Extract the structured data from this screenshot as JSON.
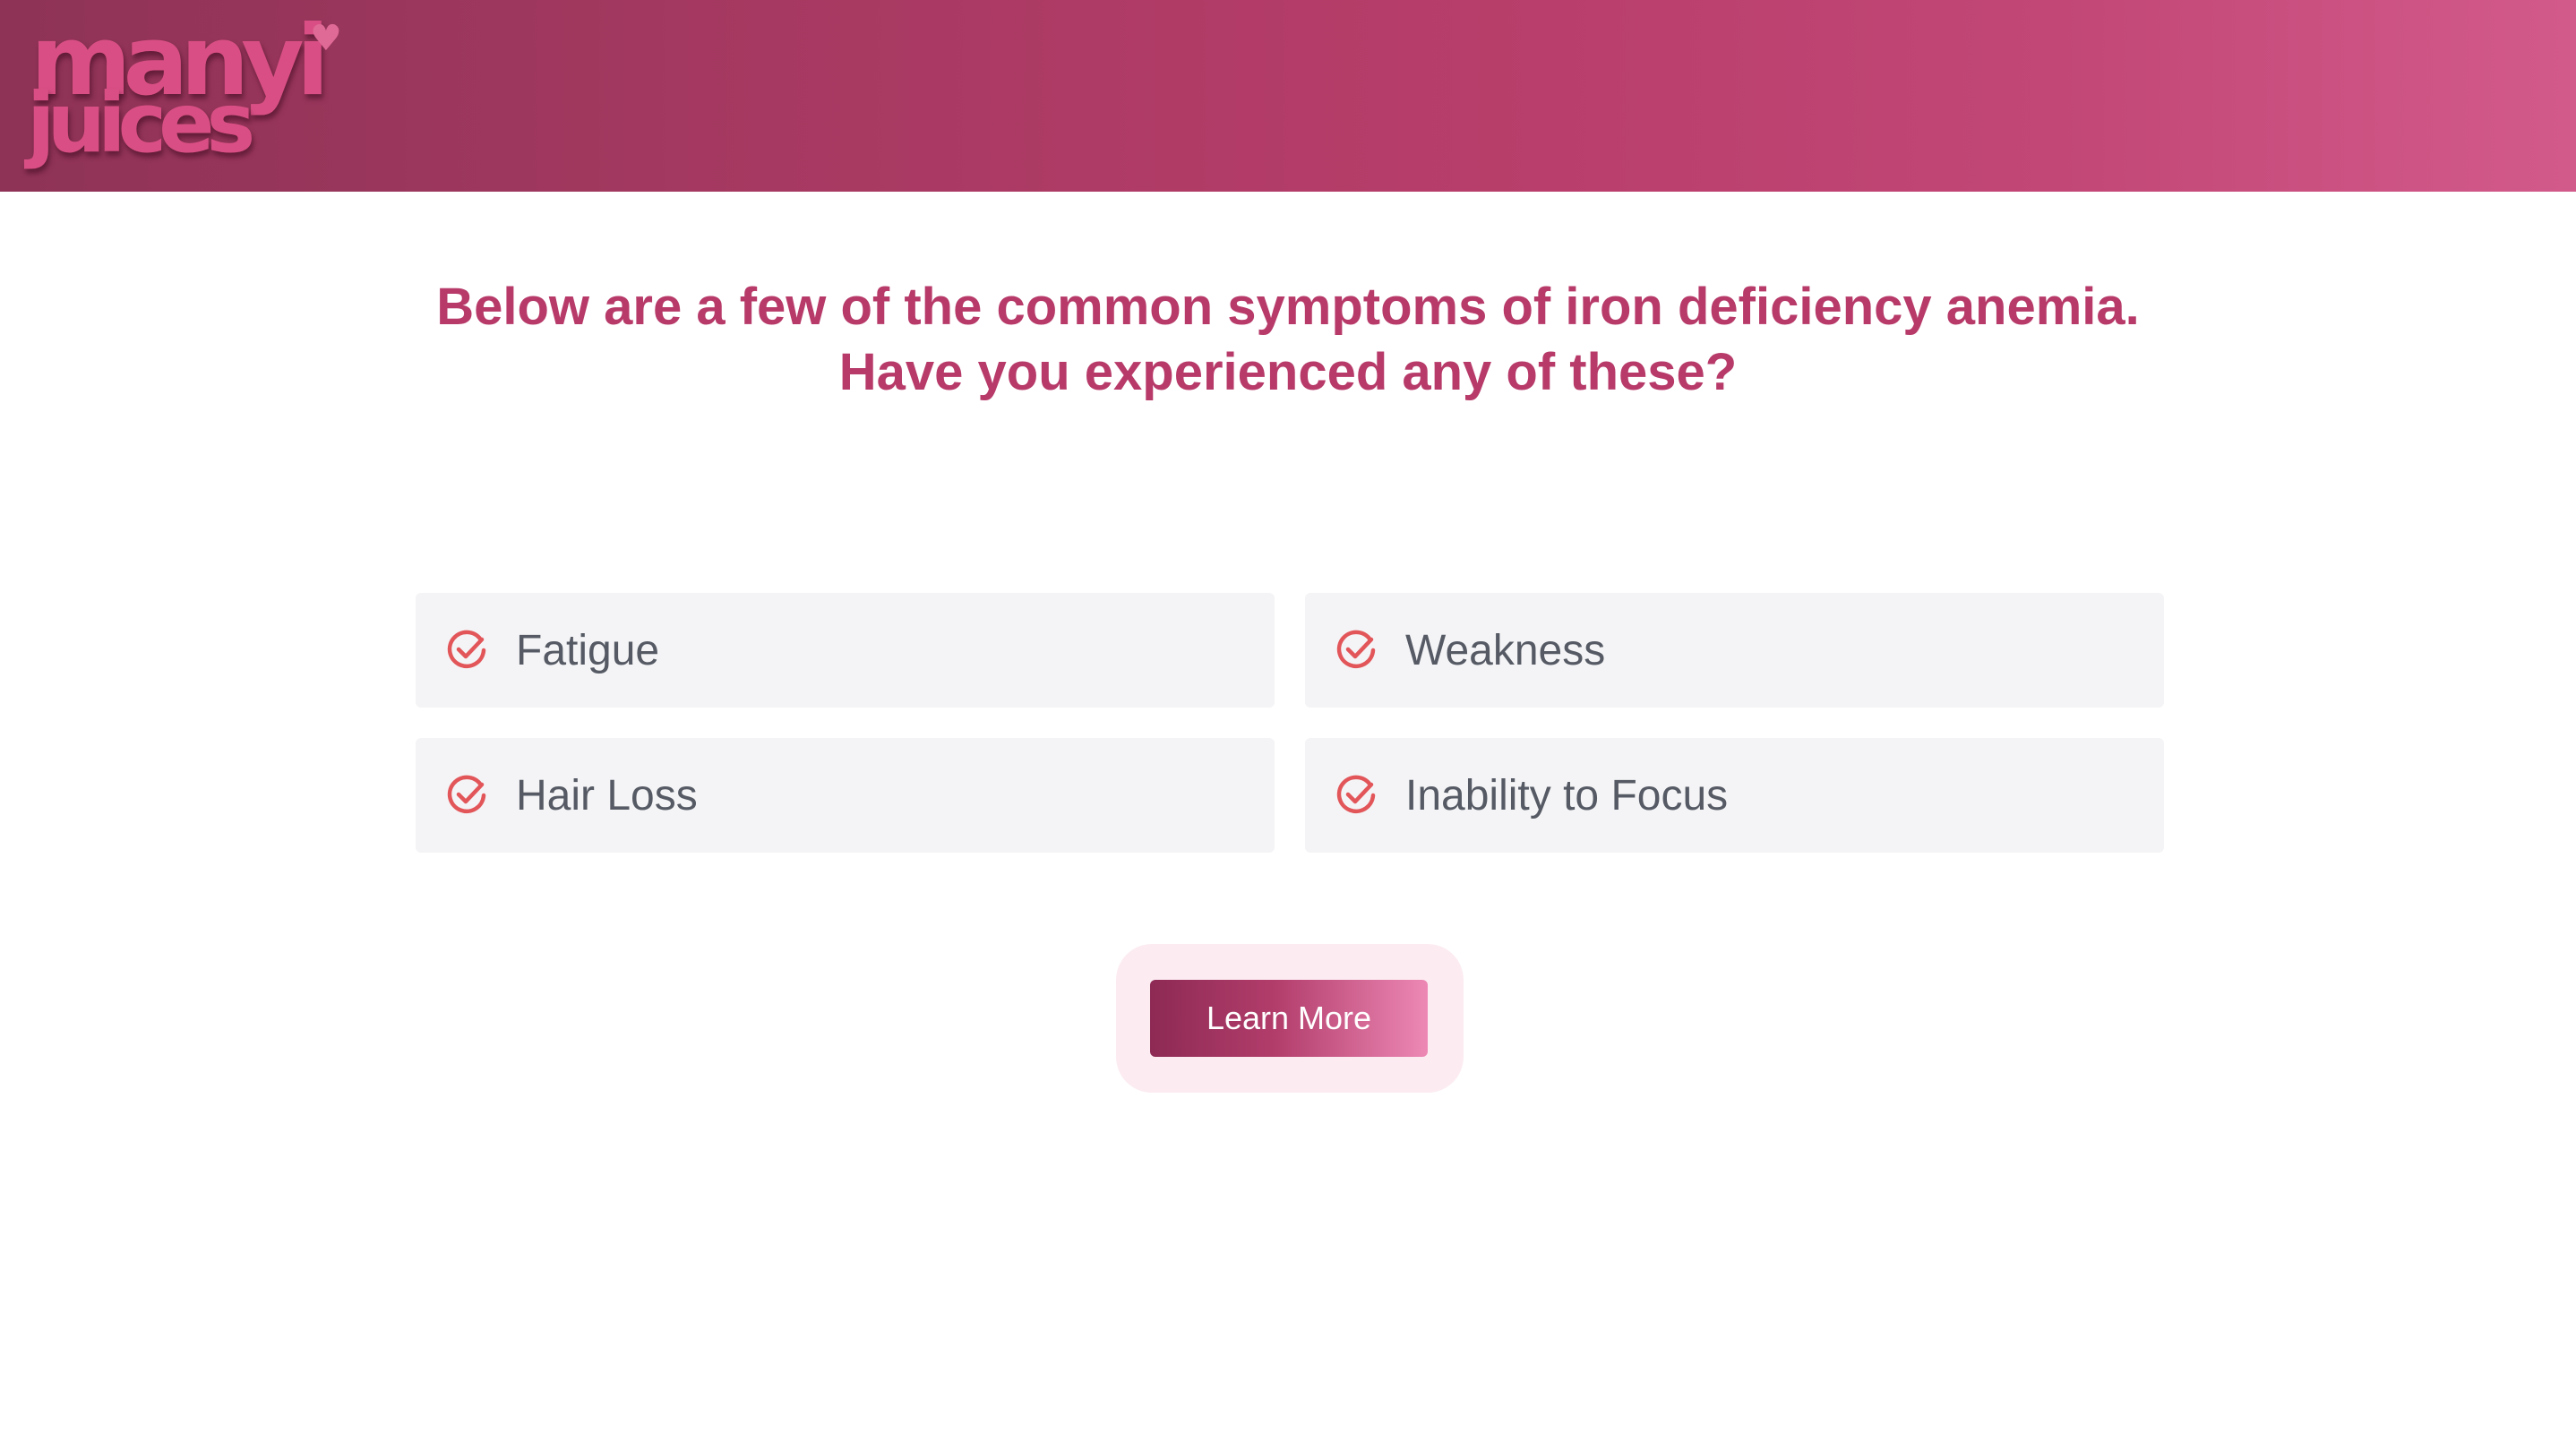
{
  "brand": {
    "logo_line1": "manyi",
    "logo_line2": "juices",
    "logo_heart": "♥",
    "accent_color": "#b73a69",
    "header_gradient_start": "#8e3356",
    "header_gradient_end": "#d25a8a"
  },
  "headline": {
    "line1": "Below are a few of the common symptoms of iron deficiency anemia.",
    "line2": "Have you experienced any of these?"
  },
  "symptoms": [
    {
      "label": "Fatigue",
      "icon": "check-circle-icon"
    },
    {
      "label": "Weakness",
      "icon": "check-circle-icon"
    },
    {
      "label": "Hair Loss",
      "icon": "check-circle-icon"
    },
    {
      "label": "Inability to Focus",
      "icon": "check-circle-icon"
    }
  ],
  "cta": {
    "label": "Learn More"
  }
}
